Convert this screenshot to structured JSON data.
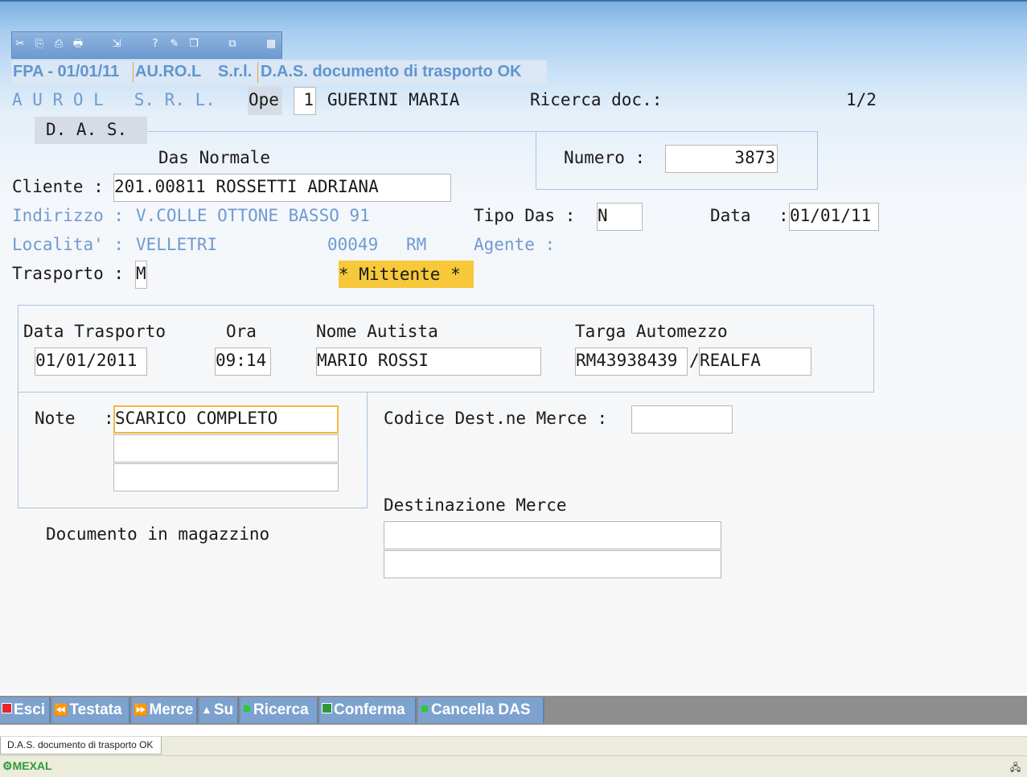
{
  "toolbar": {
    "icons": [
      "scissors-icon",
      "copy-icon",
      "paste-icon",
      "print-icon",
      "export-icon",
      "help-icon",
      "book-icon",
      "package-icon",
      "window-icon",
      "calculator-icon"
    ],
    "glyphs": [
      "✂",
      "⎘",
      "⎙",
      "🖶",
      "⇲",
      "?",
      "✎",
      "❒",
      "⧉",
      "▦"
    ]
  },
  "title": {
    "company": "FPA - 01/01/11",
    "name": "AU.RO.L",
    "suffix": "S.r.l.",
    "doc": "D.A.S. documento di trasporto OK"
  },
  "header": {
    "company_spaced": "A U R O L   S. R. L.",
    "ope_label": "Ope",
    "ope_value": "1",
    "user": "GUERINI MARIA",
    "search_label": "Ricerca doc.:",
    "page": "1/2"
  },
  "das_tab": "D. A. S.",
  "das_type": "Das Normale",
  "numero": {
    "label": "Numero :",
    "value": "3873"
  },
  "cliente": {
    "label": "Cliente :",
    "value": "201.00811 ROSSETTI ADRIANA"
  },
  "indirizzo": {
    "label": "Indirizzo :",
    "value": "V.COLLE OTTONE BASSO 91"
  },
  "localita": {
    "label": "Localita' :",
    "value": "VELLETRI",
    "cap": "00049",
    "prov": "RM"
  },
  "tipo_das": {
    "label": "Tipo Das :",
    "value": "N"
  },
  "data": {
    "label": "Data",
    "colon": ":",
    "value": "01/01/11"
  },
  "agente": {
    "label": "Agente :"
  },
  "trasporto": {
    "label": "Trasporto :",
    "value": "M",
    "badge": "* Mittente *"
  },
  "transport_panel": {
    "date_label": "Data Trasporto",
    "time_label": "Ora",
    "driver_label": "Nome Autista",
    "plate_label": "Targa Automezzo",
    "date": "01/01/2011",
    "time": "09:14",
    "driver": "MARIO ROSSI",
    "plate": "RM43938439",
    "slash": "/",
    "plate2": "REALFA"
  },
  "note": {
    "label": "Note",
    "colon": ":",
    "line1": "SCARICO COMPLETO",
    "line2": "",
    "line3": ""
  },
  "dest_code": {
    "label": "Codice Dest.ne Merce :",
    "value": ""
  },
  "destinazione": {
    "label": "Destinazione Merce",
    "line1": "",
    "line2": ""
  },
  "doc_status": "Documento in magazzino",
  "function_keys": {
    "esci": "Esci",
    "testata": "Testata",
    "merce": "Merce",
    "su": "Su",
    "ricerca": "Ricerca",
    "conferma": "Conferma",
    "cancella": "Cancella DAS"
  },
  "status_tab": "D.A.S. documento di trasporto OK",
  "app_name": "MEXAL"
}
